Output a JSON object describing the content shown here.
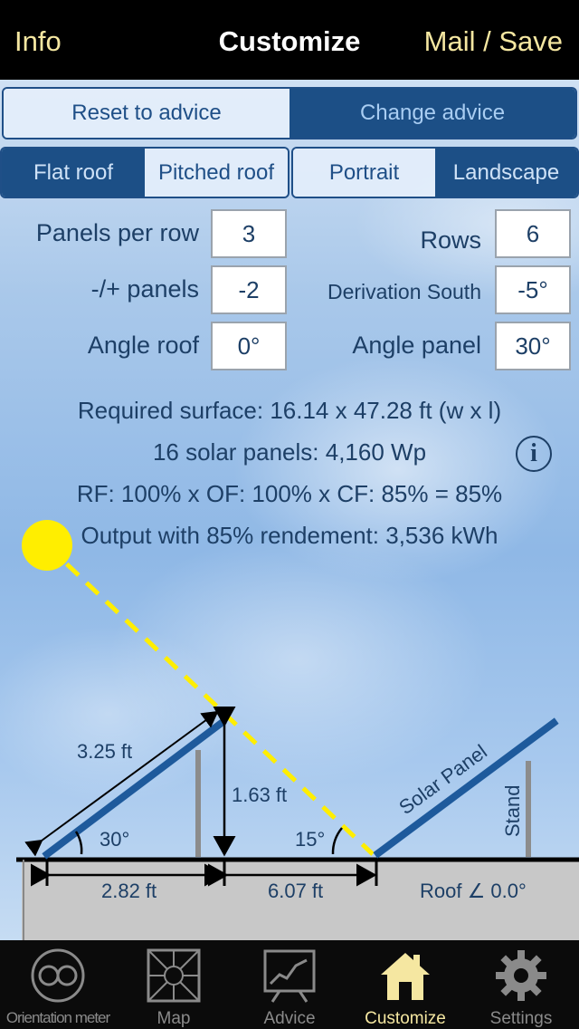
{
  "nav": {
    "left": "Info",
    "title": "Customize",
    "right": "Mail / Save"
  },
  "advice_segment": {
    "reset": "Reset to advice",
    "change": "Change advice"
  },
  "roof_segment": {
    "flat": "Flat roof",
    "pitched": "Pitched roof",
    "selected": "Flat roof"
  },
  "orientation_segment": {
    "portrait": "Portrait",
    "landscape": "Landscape",
    "selected": "Landscape"
  },
  "form": {
    "panels_per_row_label": "Panels per row",
    "panels_per_row": "3",
    "rows_label": "Rows",
    "rows": "6",
    "plus_minus_label": "-/+ panels",
    "plus_minus": "-2",
    "derivation_label": "Derivation South",
    "derivation": "-5°",
    "angle_roof_label": "Angle roof",
    "angle_roof": "0°",
    "angle_panel_label": "Angle panel",
    "angle_panel": "30°"
  },
  "results": {
    "surface": "Required surface: 16.14 x 47.28 ft (w x l)",
    "panels": "16 solar panels: 4,160 Wp",
    "factors": "RF: 100% x OF: 100% x CF: 85% = 85%",
    "output": "Output with 85% rendement: 3,536 kWh",
    "info_glyph": "i"
  },
  "diagram": {
    "panel_length": "3.25 ft",
    "panel_height": "1.63 ft",
    "panel_angle": "30°",
    "sun_angle": "15°",
    "base_length": "2.82 ft",
    "spacing": "6.07 ft",
    "solar_panel_label": "Solar Panel",
    "stand_label": "Stand",
    "roof_label": "Roof ∠ 0.0°"
  },
  "tabs": [
    {
      "label": "Orientation meter",
      "icon": "orientation-meter-icon"
    },
    {
      "label": "Map",
      "icon": "map-icon"
    },
    {
      "label": "Advice",
      "icon": "advice-chart-icon"
    },
    {
      "label": "Customize",
      "icon": "house-icon",
      "active": true
    },
    {
      "label": "Settings",
      "icon": "gear-icon"
    }
  ],
  "colors": {
    "nav_bg": "#000000",
    "nav_text": "#f5e7a1",
    "segment_dark": "#1c4f86",
    "text_dark": "#1d3f66",
    "sun": "#ffee00",
    "panel": "#1e5a9c",
    "tab_active": "#f5e7a1"
  }
}
